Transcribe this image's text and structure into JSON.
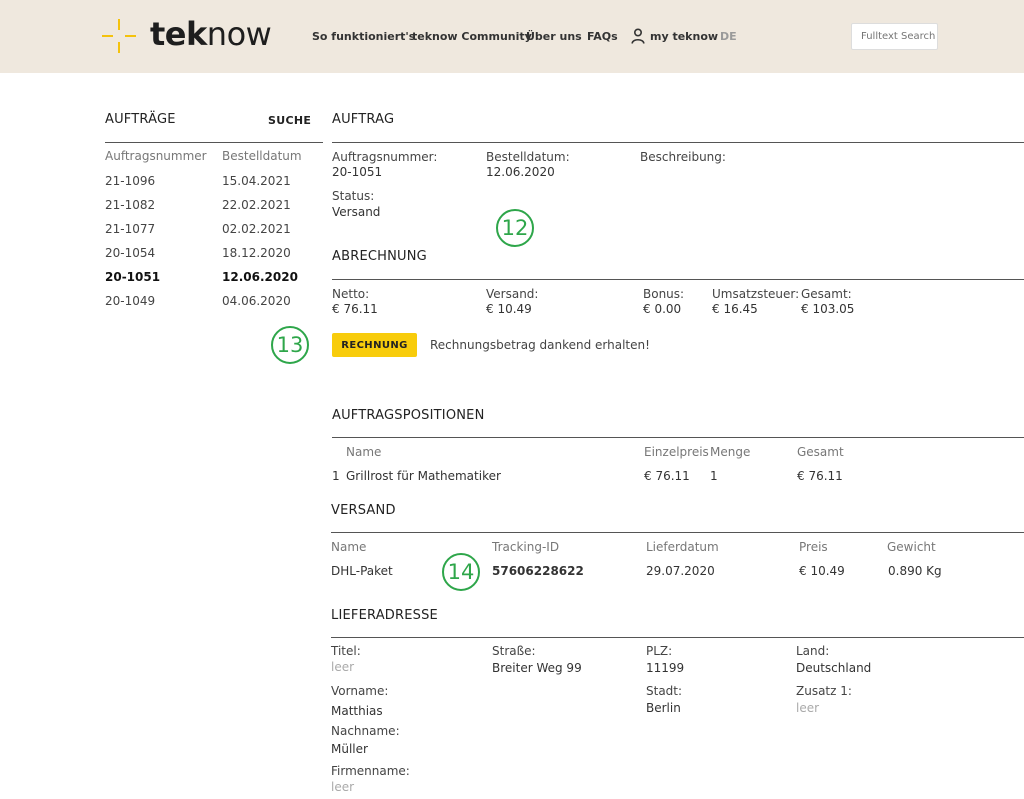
{
  "header": {
    "logo_text_bold": "tek",
    "logo_text_light": "now",
    "nav": [
      "So funktioniert's",
      "teknow Community",
      "Über uns",
      "FAQs",
      "my teknow"
    ],
    "language": "DE",
    "search_placeholder": "Fulltext Search",
    "icons": {
      "logo": "plus-sparkle-logo-icon",
      "account": "user-icon"
    }
  },
  "orders": {
    "title": "AUFTRÄGE",
    "search_label": "SUCHE",
    "col_number": "Auftragsnummer",
    "col_date": "Bestelldatum",
    "rows": [
      {
        "number": "21-1096",
        "date": "15.04.2021"
      },
      {
        "number": "21-1082",
        "date": "22.02.2021"
      },
      {
        "number": "21-1077",
        "date": "02.02.2021"
      },
      {
        "number": "20-1054",
        "date": "18.12.2020"
      },
      {
        "number": "20-1051",
        "date": "12.06.2020"
      },
      {
        "number": "20-1049",
        "date": "04.06.2020"
      }
    ],
    "selected_index": 4
  },
  "auftrag": {
    "title": "AUFTRAG",
    "number_label": "Auftragsnummer:",
    "number_value": "20-1051",
    "date_label": "Bestelldatum:",
    "date_value": "12.06.2020",
    "description_label": "Beschreibung:",
    "status_label": "Status:",
    "status_value": "Versand"
  },
  "abrechnung": {
    "title": "ABRECHNUNG",
    "netto_label": "Netto:",
    "netto_value": "€ 76.11",
    "versand_label": "Versand:",
    "versand_value": "€ 10.49",
    "bonus_label": "Bonus:",
    "bonus_value": "€ 0.00",
    "ust_label": "Umsatzsteuer:",
    "ust_value": "€ 16.45",
    "gesamt_label": "Gesamt:",
    "gesamt_value": "€ 103.05",
    "invoice_button": "RECHNUNG",
    "payment_message": "Rechnungsbetrag dankend erhalten!"
  },
  "positionen": {
    "title": "AUFTRAGSPOSITIONEN",
    "col_name": "Name",
    "col_unit_price": "Einzelpreis",
    "col_qty": "Menge",
    "col_total": "Gesamt",
    "rows": [
      {
        "pos": "1",
        "name": "Grillrost für Mathematiker",
        "unit_price": "€ 76.11",
        "qty": "1",
        "total": "€ 76.11"
      }
    ]
  },
  "versand": {
    "title": "VERSAND",
    "col_name": "Name",
    "col_tracking": "Tracking-ID",
    "col_delivery": "Lieferdatum",
    "col_price": "Preis",
    "col_weight": "Gewicht",
    "name": "DHL-Paket",
    "tracking": "57606228622",
    "delivery": "29.07.2020",
    "price": "€ 10.49",
    "weight": "0.890 Kg"
  },
  "lieferadresse": {
    "title": "LIEFERADRESSE",
    "titel_label": "Titel:",
    "titel_value": "leer",
    "strasse_label": "Straße:",
    "strasse_value": "Breiter Weg 99",
    "plz_label": "PLZ:",
    "plz_value": "11199",
    "land_label": "Land:",
    "land_value": "Deutschland",
    "vorname_label": "Vorname:",
    "vorname_value": "Matthias",
    "stadt_label": "Stadt:",
    "stadt_value": "Berlin",
    "zusatz_label": "Zusatz 1:",
    "zusatz_value": "leer",
    "nachname_label": "Nachname:",
    "nachname_value": "Müller",
    "firma_label": "Firmenname:",
    "firma_value": "leer"
  },
  "annotations": [
    "12",
    "13",
    "14"
  ],
  "colors": {
    "header_bg": "#efe8de",
    "accent_yellow": "#f8cc0b",
    "marker_green": "#2ea64a"
  }
}
